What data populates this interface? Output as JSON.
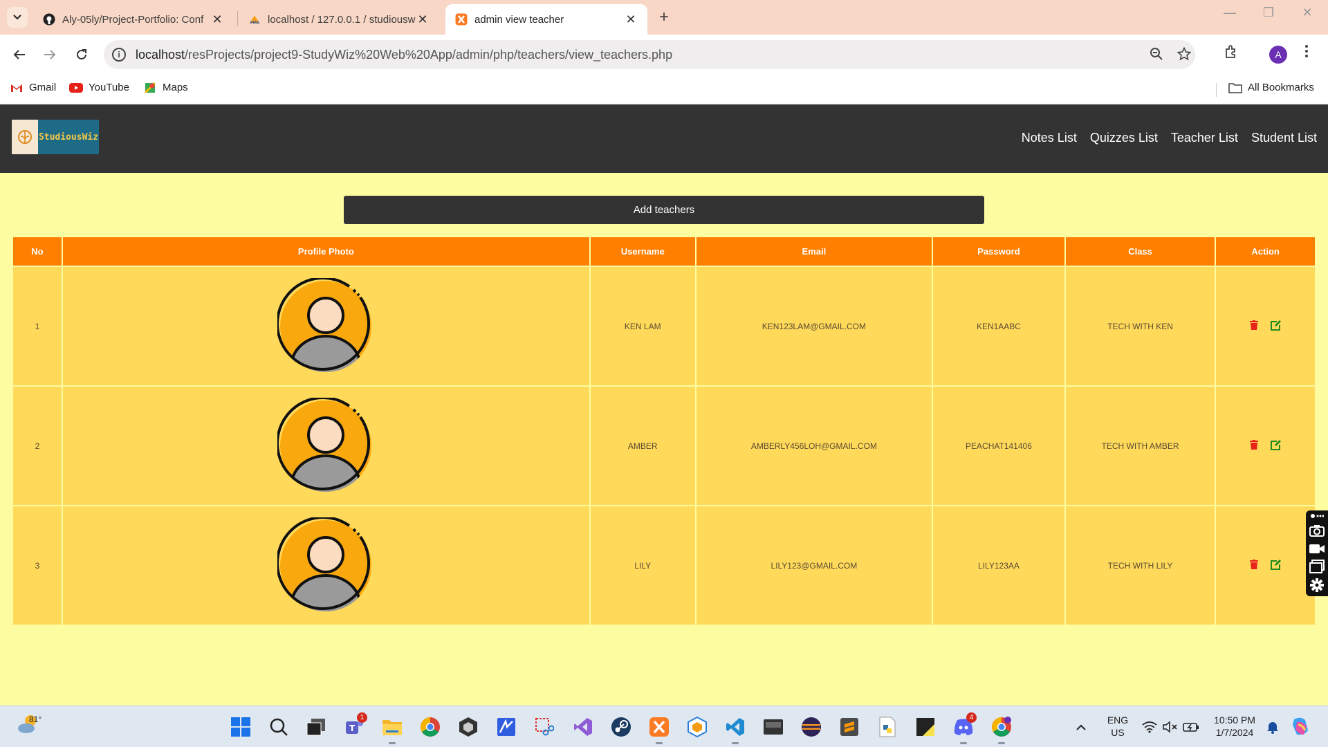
{
  "browser": {
    "tabs": [
      {
        "title": "Aly-05ly/Project-Portfolio: Conf",
        "icon": "github-icon"
      },
      {
        "title": "localhost / 127.0.0.1 / studiousw",
        "icon": "phpmyadmin-icon"
      },
      {
        "title": "admin view teacher",
        "icon": "xampp-icon",
        "active": true
      }
    ],
    "url_host": "localhost",
    "url_path": "/resProjects/project9-StudyWiz%20Web%20App/admin/php/teachers/view_teachers.php",
    "profile_initial": "A",
    "bookmarks": [
      {
        "label": "Gmail",
        "icon": "gmail-icon"
      },
      {
        "label": "YouTube",
        "icon": "youtube-icon"
      },
      {
        "label": "Maps",
        "icon": "maps-icon"
      }
    ],
    "all_bookmarks": "All Bookmarks"
  },
  "site": {
    "logo_text": "StudiousWiz",
    "nav": [
      "Notes List",
      "Quizzes List",
      "Teacher List",
      "Student List"
    ],
    "add_button": "Add teachers"
  },
  "table": {
    "headers": [
      "No",
      "Profile Photo",
      "Username",
      "Email",
      "Password",
      "Class",
      "Action"
    ],
    "rows": [
      {
        "no": "1",
        "username": "KEN LAM",
        "email": "KEN123LAM@GMAIL.COM",
        "password": "KEN1AABC",
        "class": "TECH WITH KEN"
      },
      {
        "no": "2",
        "username": "AMBER",
        "email": "AMBERLY456LOH@GMAIL.COM",
        "password": "PEACHAT141406",
        "class": "TECH WITH AMBER"
      },
      {
        "no": "3",
        "username": "LILY",
        "email": "LILY123@GMAIL.COM",
        "password": "LILY123AA",
        "class": "TECH WITH LILY"
      }
    ]
  },
  "colors": {
    "page_bg": "#fdfca1",
    "header_bg": "#333333",
    "table_header": "#ff7f00",
    "table_cell": "#ffd95a",
    "delete": "#e8231b",
    "edit": "#1f8a1f"
  },
  "taskbar": {
    "weather_temp": "81°",
    "language": "ENG",
    "region": "US",
    "time": "10:50 PM",
    "date": "1/7/2024",
    "teams_badge": "1",
    "discord_badge": "4"
  }
}
